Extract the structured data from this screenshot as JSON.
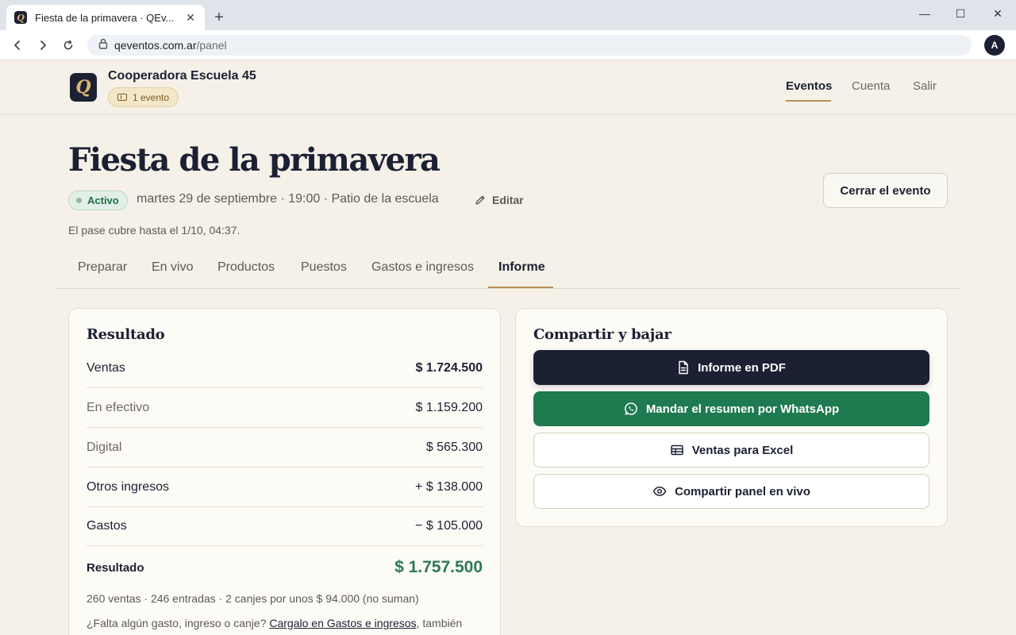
{
  "browser": {
    "tab_title": "Fiesta de la primavera · QEv...",
    "url_host": "qeventos.com.ar",
    "url_path": "/panel",
    "profile_initial": "A",
    "icons": [
      "back-icon",
      "forward-icon",
      "reload-icon",
      "lock-icon",
      "close-icon",
      "plus-icon"
    ]
  },
  "header": {
    "logo_letter": "Q",
    "org_name": "Cooperadora Escuela 45",
    "event_count": "1 evento",
    "nav": [
      {
        "label": "Eventos",
        "active": true
      },
      {
        "label": "Cuenta",
        "active": false
      },
      {
        "label": "Salir",
        "active": false
      }
    ]
  },
  "event": {
    "title": "Fiesta de la primavera",
    "status": "Activo",
    "meta": "martes 29 de septiembre · 19:00 · Patio de la escuela",
    "edit_label": "Editar",
    "close_label": "Cerrar el evento",
    "pass_note": "El pase cubre hasta el 1/10, 04:37."
  },
  "tabs": [
    {
      "label": "Preparar",
      "active": false
    },
    {
      "label": "En vivo",
      "active": false
    },
    {
      "label": "Productos",
      "active": false
    },
    {
      "label": "Puestos",
      "active": false
    },
    {
      "label": "Gastos e ingresos",
      "active": false
    },
    {
      "label": "Informe",
      "active": true
    }
  ],
  "result": {
    "title": "Resultado",
    "rows": [
      {
        "label": "Ventas",
        "value": "$ 1.724.500"
      },
      {
        "label": "En efectivo",
        "value": "$ 1.159.200"
      },
      {
        "label": "Digital",
        "value": "$ 565.300"
      },
      {
        "label": "Otros ingresos",
        "value": "+ $ 138.000"
      },
      {
        "label": "Gastos",
        "value": "− $ 105.000"
      }
    ],
    "total_label": "Resultado",
    "total_value": "$ 1.757.500",
    "summary": "260 ventas · 246 entradas · 2 canjes por unos $ 94.000 (no suman)",
    "missing_prefix": "¿Falta algún gasto, ingreso o canje? ",
    "missing_link": "Cargalo en Gastos e ingresos",
    "missing_suffix": ", también"
  },
  "share": {
    "title": "Compartir y bajar",
    "buttons": [
      {
        "label": "Informe en PDF",
        "icon": "document-icon"
      },
      {
        "label": "Mandar el resumen por WhatsApp",
        "icon": "whatsapp-icon"
      },
      {
        "label": "Ventas para Excel",
        "icon": "table-icon"
      },
      {
        "label": "Compartir panel en vivo",
        "icon": "eye-icon"
      }
    ]
  },
  "colors": {
    "navy": "#1c2033",
    "cream": "#f5f1e8",
    "gold": "#b78f52",
    "green": "#1f7a4f",
    "total_green": "#2e7a50"
  }
}
